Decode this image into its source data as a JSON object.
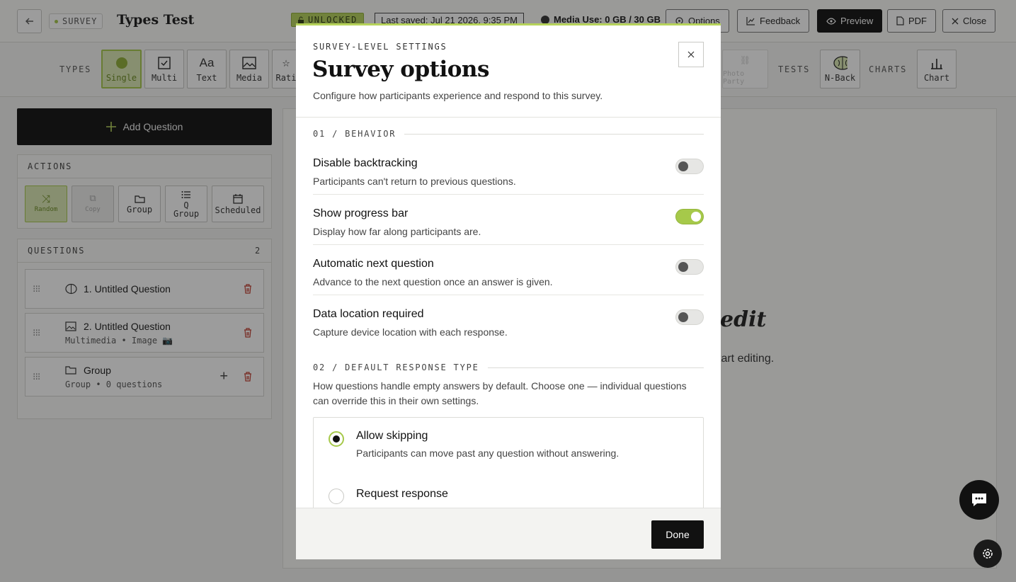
{
  "topbar": {
    "survey_tag": "SURVEY",
    "title": "Types Test",
    "unlocked": "UNLOCKED",
    "last_saved": "Last saved: Jul 21 2026, 9:35 PM",
    "media_use": "Media Use: 0 GB / 30 GB",
    "options": "Options",
    "feedback": "Feedback",
    "preview": "Preview",
    "pdf": "PDF",
    "close": "Close"
  },
  "typesbar": {
    "types_label": "TYPES",
    "single": "Single",
    "multi": "Multi",
    "text": "Text",
    "media": "Media",
    "rating": "Rati",
    "disabled_tile": "Photo Party",
    "tests_label": "TESTS",
    "nback": "N-Back",
    "charts_label": "CHARTS",
    "chart": "Chart"
  },
  "left": {
    "add_question": "Add Question",
    "actions_label": "ACTIONS",
    "actions": {
      "random": "Random",
      "copy": "Copy",
      "group": "Group",
      "q_group": "Q\nGroup",
      "scheduled": "Scheduled"
    },
    "questions_label": "QUESTIONS",
    "questions_count": "2",
    "questions": [
      {
        "title": "1. Untitled Question",
        "subtitle": ""
      },
      {
        "title": "2. Untitled Question",
        "subtitle": "Multimedia • Image 📷"
      },
      {
        "title": "Group",
        "subtitle": "Group • 0 questions"
      }
    ]
  },
  "canvas": {
    "edit_fragment": "edit",
    "start_fragment": "tart editing."
  },
  "modal": {
    "eyebrow": "SURVEY-LEVEL SETTINGS",
    "title": "Survey options",
    "subtitle": "Configure how participants experience and respond to this survey.",
    "section1": "01 / BEHAVIOR",
    "settings": [
      {
        "title": "Disable backtracking",
        "desc": "Participants can't return to previous questions.",
        "on": false
      },
      {
        "title": "Show progress bar",
        "desc": "Display how far along participants are.",
        "on": true
      },
      {
        "title": "Automatic next question",
        "desc": "Advance to the next question once an answer is given.",
        "on": false
      },
      {
        "title": "Data location required",
        "desc": "Capture device location with each response.",
        "on": false
      }
    ],
    "section2": "02 / DEFAULT RESPONSE TYPE",
    "response_desc": "How questions handle empty answers by default. Choose one — individual questions can override this in their own settings.",
    "options": [
      {
        "title": "Allow skipping",
        "desc": "Participants can move past any question without answering.",
        "selected": true
      },
      {
        "title": "Request response",
        "desc": "",
        "selected": false
      }
    ],
    "done": "Done"
  },
  "colors": {
    "accent": "#b6d35a",
    "accent_dark": "#a6c94a",
    "danger": "#c0392b"
  }
}
